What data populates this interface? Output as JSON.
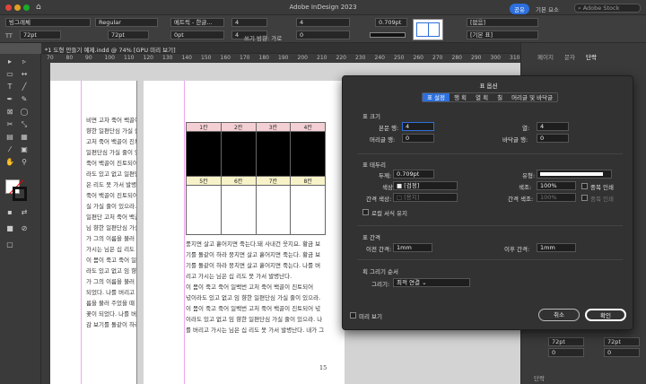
{
  "app": {
    "title": "Adobe InDesign 2023",
    "share": "공유",
    "workspace": "기본 요소",
    "search_placeholder": "Adobe Stock"
  },
  "control": {
    "font_family": "빙그레체",
    "font_style": "Regular",
    "font_size": "72pt",
    "leading": "72pt",
    "kerning_label": "메트릭 - 한글...",
    "baseline": "0pt",
    "rows": "4",
    "cols": "4",
    "stroke_weight": "0.709pt",
    "orientation_label": "쓰기 방향: 가로",
    "row_height": "0",
    "style_top": "[없음]",
    "style_bottom": "[기본 표]"
  },
  "doc_tab": "*1 도형 만들기 예제.indd @ 74% [GPU 미리 보기]",
  "ruler_ticks": [
    "70",
    "80",
    "90",
    "100",
    "110",
    "120",
    "130",
    "140",
    "150",
    "160",
    "170",
    "180",
    "190",
    "200",
    "210",
    "220",
    "230",
    "240",
    "250",
    "260",
    "270",
    "280",
    "290",
    "300",
    "310"
  ],
  "left_page_lines": [
    "비면 고차 죽어 백골이",
    "향한 일편단심 가실 줄이",
    "고처 죽어 백골이 진토되",
    "일편단심 가실 줄이 있으",
    "죽어 백골이 진토되어",
    "라도 있고 없고 일편단",
    "은 리도 못 가서 발병난다",
    "죽어 백골이 진토되어 넋",
    "실 가실 줄이 있으라. 나",
    "일편단 고처 죽어 백골",
    "님 향한 일편단심 가실",
    "가 그의 이름을 불러 주",
    "",
    "가시는 님은 십 리도 못",
    "이 몸이 죽고 죽어 일백",
    "라도 있고 없고 임 향한",
    "가 그의 이름을 불러 주",
    "되었다. 나를 버리고 가",
    "",
    "름을 불러 주었을 때 그",
    "꽃이 되었다. 나를 버리",
    "감 보기를 돌같이 하라"
  ],
  "table": {
    "header_row": [
      "1칸",
      "2칸",
      "3칸",
      "4칸"
    ],
    "row2": [
      "5칸",
      "6칸",
      "7칸",
      "8칸"
    ]
  },
  "right_page_lines": [
    "풍지면 살고 흩어지면 죽는다.돼 사내건 웃지요. 황금 보",
    "기를 돌같이 하라 뭉치면 살고 흩어지면 죽는다. 황금 보",
    "기를 돌같이 하라 뭉치면 살고 흩어지면 죽는다. 나를 버",
    "리고 가시는 님은 십 리도 못 가서 발병난다.",
    "  이 몸이 죽고 죽어 일백번 고처 죽어 백골이 진토되어",
    "넋이라도 있고 없고 임 향한 일편단심 가실 줄이 있으라.",
    "이 몸이 죽고 죽어 일백번 고처 죽어 백골이 진토되어 넋",
    "이라도 있고 없고 임 향한 일편단심 가실 줄이 있으라. 나",
    "를 버리고 가시는 님은 십 리도 못 가서 발병난다. 내가 그"
  ],
  "page_number": "15",
  "dialog": {
    "title": "표 옵션",
    "tabs": [
      "표 설정",
      "행 획",
      "열 획",
      "칠",
      "머리글 및 바닥글"
    ],
    "size_section": "표 크기",
    "body_rows_label": "본문 행:",
    "body_rows": "4",
    "cols_label": "열:",
    "cols": "4",
    "header_rows_label": "머리글 행:",
    "header_rows": "0",
    "footer_rows_label": "바닥글 행:",
    "footer_rows": "0",
    "border_section": "표 테두리",
    "weight_label": "두께:",
    "weight": "0.709pt",
    "type_label": "유형:",
    "color_label": "색상:",
    "color_value": "[검정]",
    "tint_label": "색조:",
    "tint": "100%",
    "overprint": "중복 인쇄",
    "gap_color_label": "간격 색상:",
    "gap_color_value": "[용지]",
    "gap_tint_label": "간격 색조:",
    "gap_tint": "100%",
    "gap_overprint": "중복 인쇄",
    "preserve_local": "로컬 서식 유지",
    "spacing_section": "표 간격",
    "before_label": "이전 간격:",
    "before": "1mm",
    "after_label": "이후 간격:",
    "after": "1mm",
    "draw_section": "획 그리기 순서",
    "draw_label": "그리기:",
    "draw_value": "최적 연결",
    "preview": "미리 보기",
    "cancel": "취소",
    "ok": "확인"
  },
  "right_panel": {
    "tabs": [
      "페이지",
      "문자",
      "단락"
    ],
    "fields": [
      "72pt",
      "72pt",
      "0",
      "0"
    ],
    "section": "단락"
  }
}
